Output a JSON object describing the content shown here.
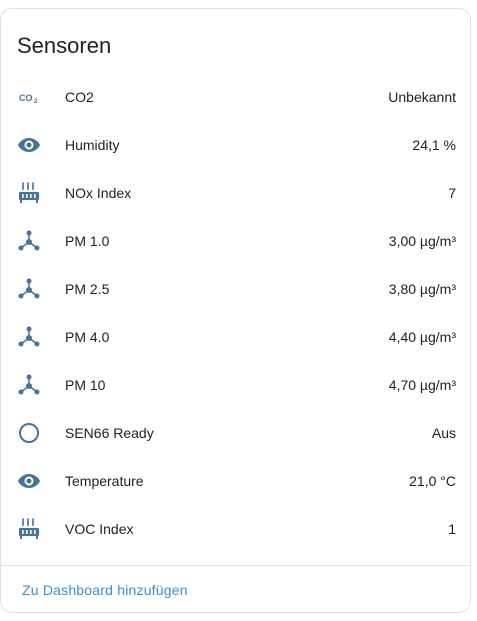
{
  "card": {
    "title": "Sensoren",
    "footer_link": "Zu Dashboard hinzufügen"
  },
  "rows": [
    {
      "name": "CO2",
      "value": "Unbekannt",
      "icon": "co2-icon"
    },
    {
      "name": "Humidity",
      "value": "24,1 %",
      "icon": "eye-icon"
    },
    {
      "name": "NOx Index",
      "value": "7",
      "icon": "radiator-icon"
    },
    {
      "name": "PM 1.0",
      "value": "3,00 µg/m³",
      "icon": "molecule-icon"
    },
    {
      "name": "PM 2.5",
      "value": "3,80 µg/m³",
      "icon": "molecule-icon"
    },
    {
      "name": "PM 4.0",
      "value": "4,40 µg/m³",
      "icon": "molecule-icon"
    },
    {
      "name": "PM 10",
      "value": "4,70 µg/m³",
      "icon": "molecule-icon"
    },
    {
      "name": "SEN66 Ready",
      "value": "Aus",
      "icon": "circle-outline-icon"
    },
    {
      "name": "Temperature",
      "value": "21,0 °C",
      "icon": "eye-icon"
    },
    {
      "name": "VOC Index",
      "value": "1",
      "icon": "radiator-icon"
    }
  ],
  "colors": {
    "icon": "#44739e",
    "link": "#3a8fcf",
    "text": "#212121",
    "divider": "#e0e0e0"
  }
}
